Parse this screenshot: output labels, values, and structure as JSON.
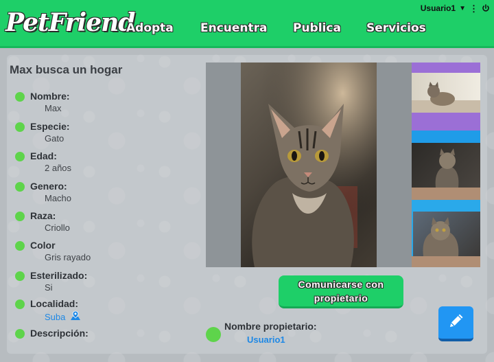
{
  "header": {
    "logo": "PetFriend",
    "nav": [
      "Adopta",
      "Encuentra",
      "Publica",
      "Servicios"
    ],
    "username": "Usuario1",
    "icons": [
      "chevron-down-icon",
      "kebab-menu-icon",
      "power-icon"
    ]
  },
  "pet": {
    "title": "Max busca un hogar",
    "fields": [
      {
        "label": "Nombre:",
        "value": "Max"
      },
      {
        "label": "Especie:",
        "value": "Gato"
      },
      {
        "label": "Edad:",
        "value": "2 años"
      },
      {
        "label": "Genero:",
        "value": "Macho"
      },
      {
        "label": "Raza:",
        "value": "Criollo"
      },
      {
        "label": "Color",
        "value": "Gris rayado"
      },
      {
        "label": "Esterilizado:",
        "value": "Si"
      },
      {
        "label": "Localidad:",
        "value": "Suba"
      },
      {
        "label": "Descripción:",
        "value": ""
      }
    ]
  },
  "actions": {
    "contact_line1": "Comunicarse con",
    "contact_line2": "propietario"
  },
  "owner": {
    "label": "Nombre propietario:",
    "value": "Usuario1"
  },
  "colors": {
    "primary": "#1ecf68",
    "accent_blue": "#2196f3",
    "dot_green": "#5ed44b"
  }
}
